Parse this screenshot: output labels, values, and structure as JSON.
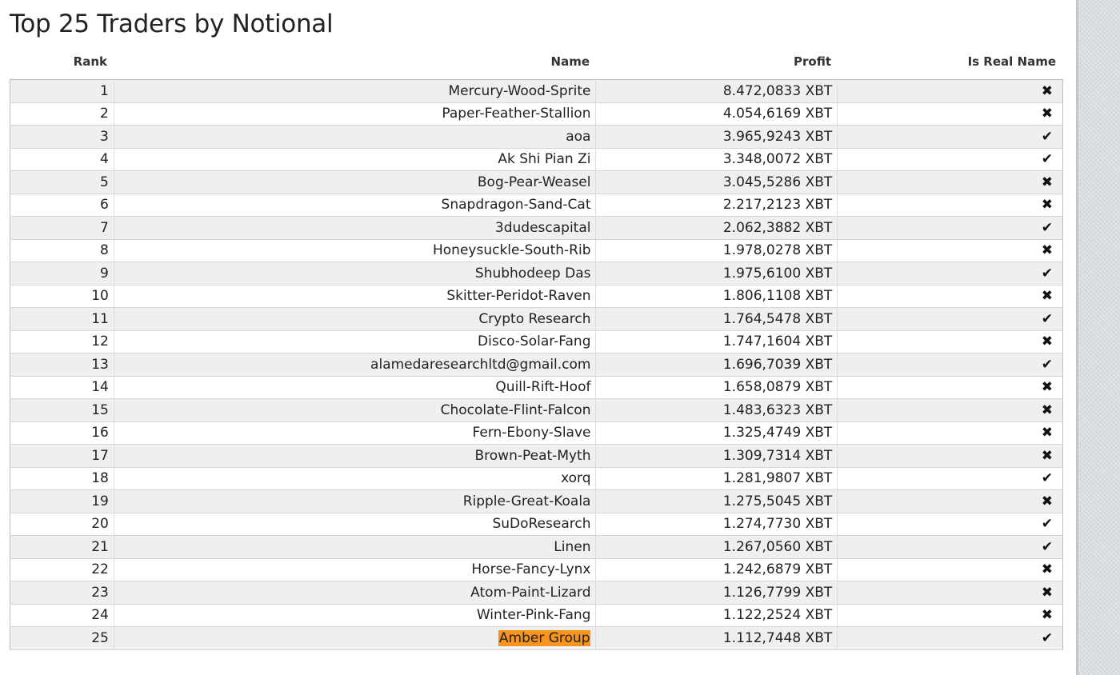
{
  "title": "Top 25 Traders by Notional",
  "columns": {
    "rank": "Rank",
    "name": "Name",
    "profit": "Profit",
    "is_real_name": "Is Real Name"
  },
  "icons": {
    "true": "✔",
    "false": "✖"
  },
  "rows": [
    {
      "rank": "1",
      "name": "Mercury-Wood-Sprite",
      "profit": "8.472,0833 XBT",
      "real": false
    },
    {
      "rank": "2",
      "name": "Paper-Feather-Stallion",
      "profit": "4.054,6169 XBT",
      "real": false
    },
    {
      "rank": "3",
      "name": "aoa",
      "profit": "3.965,9243 XBT",
      "real": true
    },
    {
      "rank": "4",
      "name": "Ak Shi Pian Zi",
      "profit": "3.348,0072 XBT",
      "real": true
    },
    {
      "rank": "5",
      "name": "Bog-Pear-Weasel",
      "profit": "3.045,5286 XBT",
      "real": false
    },
    {
      "rank": "6",
      "name": "Snapdragon-Sand-Cat",
      "profit": "2.217,2123 XBT",
      "real": false
    },
    {
      "rank": "7",
      "name": "3dudescapital",
      "profit": "2.062,3882 XBT",
      "real": true
    },
    {
      "rank": "8",
      "name": "Honeysuckle-South-Rib",
      "profit": "1.978,0278 XBT",
      "real": false
    },
    {
      "rank": "9",
      "name": "Shubhodeep Das",
      "profit": "1.975,6100 XBT",
      "real": true
    },
    {
      "rank": "10",
      "name": "Skitter-Peridot-Raven",
      "profit": "1.806,1108 XBT",
      "real": false
    },
    {
      "rank": "11",
      "name": "Crypto Research",
      "profit": "1.764,5478 XBT",
      "real": true
    },
    {
      "rank": "12",
      "name": "Disco-Solar-Fang",
      "profit": "1.747,1604 XBT",
      "real": false
    },
    {
      "rank": "13",
      "name": "alamedaresearchltd@gmail.com",
      "profit": "1.696,7039 XBT",
      "real": true
    },
    {
      "rank": "14",
      "name": "Quill-Rift-Hoof",
      "profit": "1.658,0879 XBT",
      "real": false
    },
    {
      "rank": "15",
      "name": "Chocolate-Flint-Falcon",
      "profit": "1.483,6323 XBT",
      "real": false
    },
    {
      "rank": "16",
      "name": "Fern-Ebony-Slave",
      "profit": "1.325,4749 XBT",
      "real": false
    },
    {
      "rank": "17",
      "name": "Brown-Peat-Myth",
      "profit": "1.309,7314 XBT",
      "real": false
    },
    {
      "rank": "18",
      "name": "xorq",
      "profit": "1.281,9807 XBT",
      "real": true
    },
    {
      "rank": "19",
      "name": "Ripple-Great-Koala",
      "profit": "1.275,5045 XBT",
      "real": false
    },
    {
      "rank": "20",
      "name": "SuDoResearch",
      "profit": "1.274,7730 XBT",
      "real": true
    },
    {
      "rank": "21",
      "name": "Linen",
      "profit": "1.267,0560 XBT",
      "real": true
    },
    {
      "rank": "22",
      "name": "Horse-Fancy-Lynx",
      "profit": "1.242,6879 XBT",
      "real": false
    },
    {
      "rank": "23",
      "name": "Atom-Paint-Lizard",
      "profit": "1.126,7799 XBT",
      "real": false
    },
    {
      "rank": "24",
      "name": "Winter-Pink-Fang",
      "profit": "1.122,2524 XBT",
      "real": false
    },
    {
      "rank": "25",
      "name": "Amber Group",
      "profit": "1.112,7448 XBT",
      "real": true,
      "highlighted": true
    }
  ],
  "highlight_color": "#f7941d"
}
